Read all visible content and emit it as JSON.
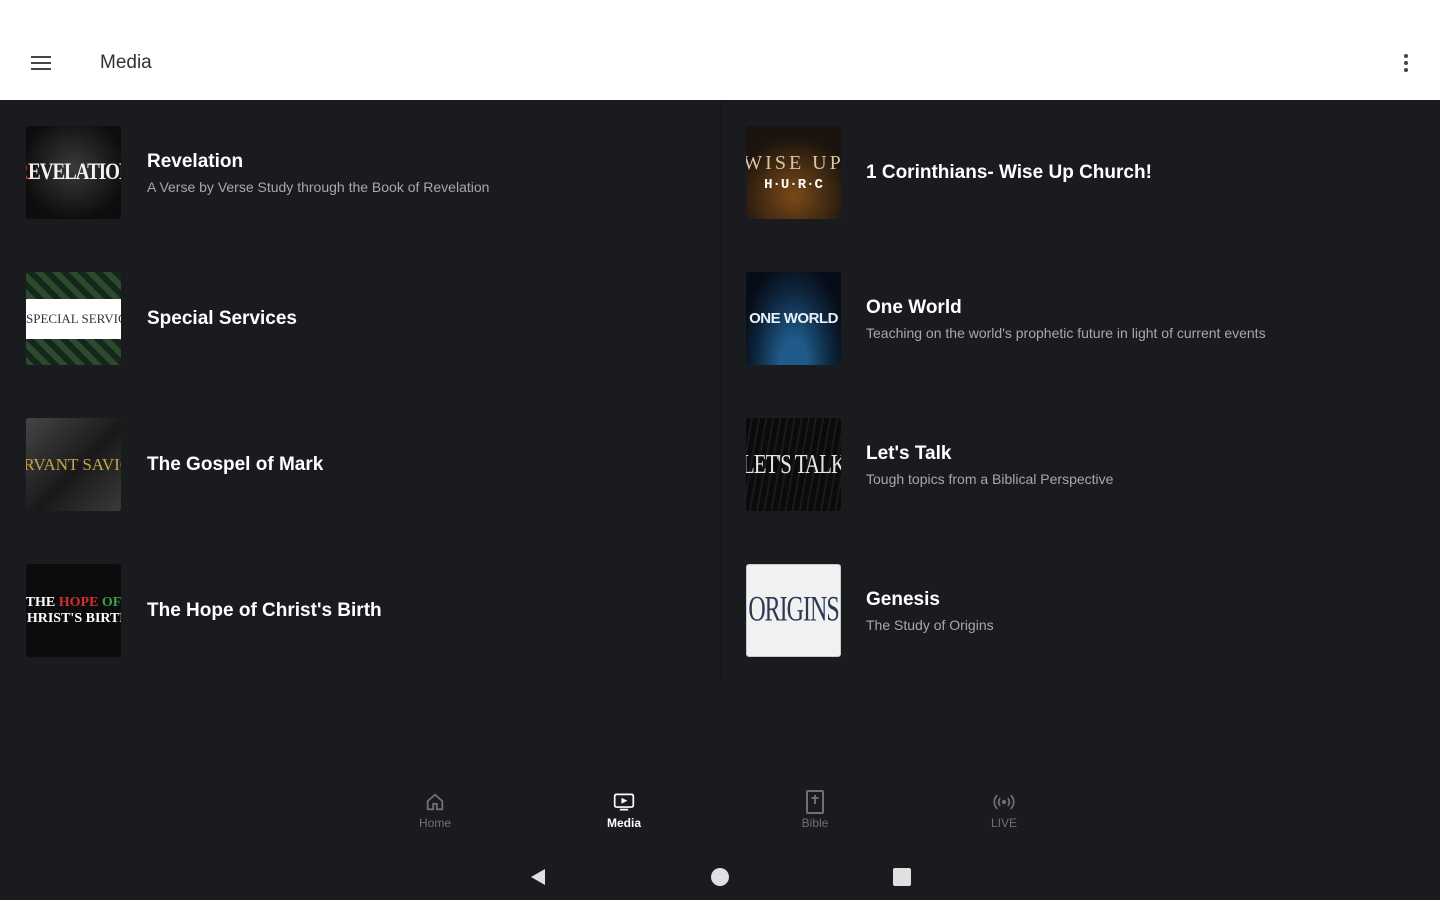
{
  "app_bar": {
    "title": "Media",
    "menu_icon": "hamburger-menu-icon",
    "more_icon": "more-vertical-icon",
    "background": "#ffffff"
  },
  "media": {
    "items": [
      {
        "title": "Revelation",
        "subtitle": "A Verse by Verse Study through the Book of Revelation",
        "thumbnail_text": "REVELATION",
        "thumbnail_text_accent": "R"
      },
      {
        "title": "1 Corinthians- Wise Up Church!",
        "subtitle": "",
        "thumbnail_text_1": "WISE UP",
        "thumbnail_text_2": "H·U·R·C"
      },
      {
        "title": "Special Services",
        "subtitle": "",
        "thumbnail_text": "SPECIAL SERVICES"
      },
      {
        "title": "One World",
        "subtitle": "Teaching on the world's prophetic future in light of current events",
        "thumbnail_text": "ONE WORLD"
      },
      {
        "title": "The Gospel of Mark",
        "subtitle": "",
        "thumbnail_text": "SERVANT SAVIOR"
      },
      {
        "title": "Let's Talk",
        "subtitle": "Tough topics from a Biblical Perspective",
        "thumbnail_text": "LET'S TALK"
      },
      {
        "title": "The Hope of Christ's Birth",
        "subtitle": "",
        "thumbnail_text_1a": "THE ",
        "thumbnail_text_1b": "HOPE",
        "thumbnail_text_1c": " OF",
        "thumbnail_text_2": "CHRIST'S BIRTH"
      },
      {
        "title": "Genesis",
        "subtitle": "The Study of Origins",
        "thumbnail_text": "ORIGINS"
      }
    ]
  },
  "bottom_nav": {
    "items": [
      {
        "label": "Home",
        "icon": "home-icon",
        "active": false
      },
      {
        "label": "Media",
        "icon": "media-icon",
        "active": true
      },
      {
        "label": "Bible",
        "icon": "bible-icon",
        "active": false
      },
      {
        "label": "LIVE",
        "icon": "live-broadcast-icon",
        "active": false
      }
    ]
  },
  "system_nav": {
    "back_icon": "back-triangle-icon",
    "home_icon": "home-circle-icon",
    "recents_icon": "recents-square-icon"
  },
  "colors": {
    "background": "#1a1b1e",
    "text_primary": "#ffffff",
    "text_secondary": "#a7a8ab",
    "nav_inactive": "#6f7073",
    "accent_red": "#d42323"
  }
}
